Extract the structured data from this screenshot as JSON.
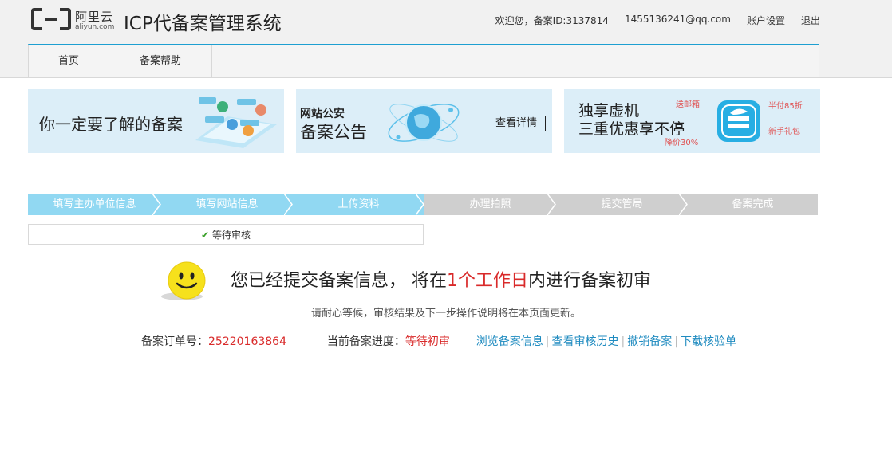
{
  "header": {
    "logo_cn": "阿里云",
    "logo_en": "aliyun.com",
    "title": "ICP代备案管理系统",
    "welcome": "欢迎您，备案ID:3137814",
    "email": "1455136241@qq.com",
    "account_settings": "账户设置",
    "logout": "退出"
  },
  "nav": {
    "items": [
      "首页",
      "备案帮助"
    ]
  },
  "banners": {
    "b1": {
      "text": "你一定要了解的备案"
    },
    "b2": {
      "line1": "网站公安",
      "line2": "备案公告",
      "button": "查看详情"
    },
    "b3": {
      "line1": "独享虚机",
      "line2": "三重优惠享不停",
      "tag1": "送邮箱",
      "tag2": "半付85折",
      "tag3": "新手礼包",
      "tag4": "降价30%"
    }
  },
  "steps": [
    "填写主办单位信息",
    "填写网站信息",
    "上传资料",
    "办理拍照",
    "提交管局",
    "备案完成"
  ],
  "status": {
    "check": "✔",
    "label": "等待审核"
  },
  "message": {
    "before": "您已经提交备案信息， 将在",
    "highlight": "1个工作日",
    "after": "内进行备案初审",
    "sub": "请耐心等候，审核结果及下一步操作说明将在本页面更新。"
  },
  "info": {
    "order_label": "备案订单号：",
    "order_no": "25220163864",
    "progress_label": "当前备案进度：",
    "progress_value": "等待初审",
    "links": [
      "浏览备案信息",
      "查看审核历史",
      "撤销备案",
      "下载核验单"
    ]
  },
  "colors": {
    "accent": "#1d9fd1",
    "step_done": "#91d8f2",
    "step_todo": "#cfcfcf",
    "highlight": "#d92a2a"
  }
}
